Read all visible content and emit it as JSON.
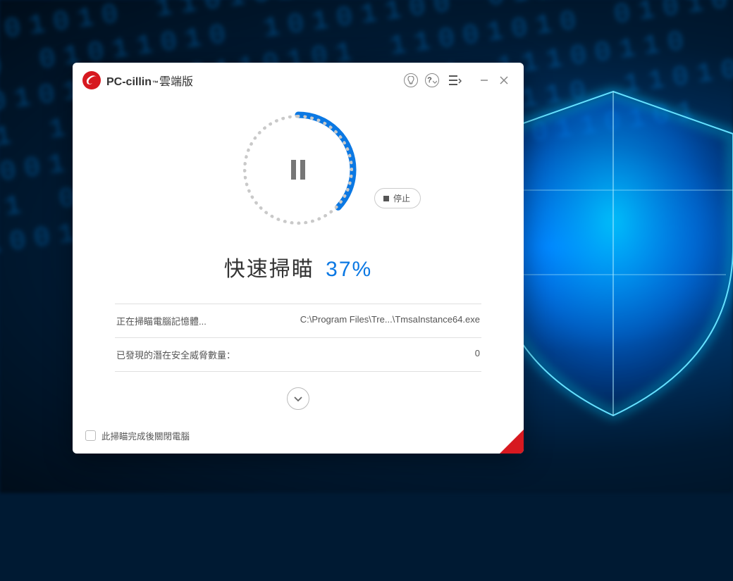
{
  "app": {
    "name_main": "PC-cillin",
    "name_tm": "™",
    "name_sub": "雲端版"
  },
  "scan": {
    "title": "快速掃瞄",
    "percent_text": "37%",
    "percent_value": 37,
    "stop_label": "停止"
  },
  "rows": {
    "scanning_label": "正在掃瞄電腦記憶體...",
    "scanning_path": "C:\\Program Files\\Tre...\\TmsaInstance64.exe",
    "threats_label": "已發現的潛在安全威脅數量：",
    "threats_count": "0"
  },
  "footer": {
    "shutdown_label": "此掃瞄完成後關閉電腦"
  },
  "colors": {
    "accent": "#0b78e3",
    "brand_red": "#d71920"
  }
}
